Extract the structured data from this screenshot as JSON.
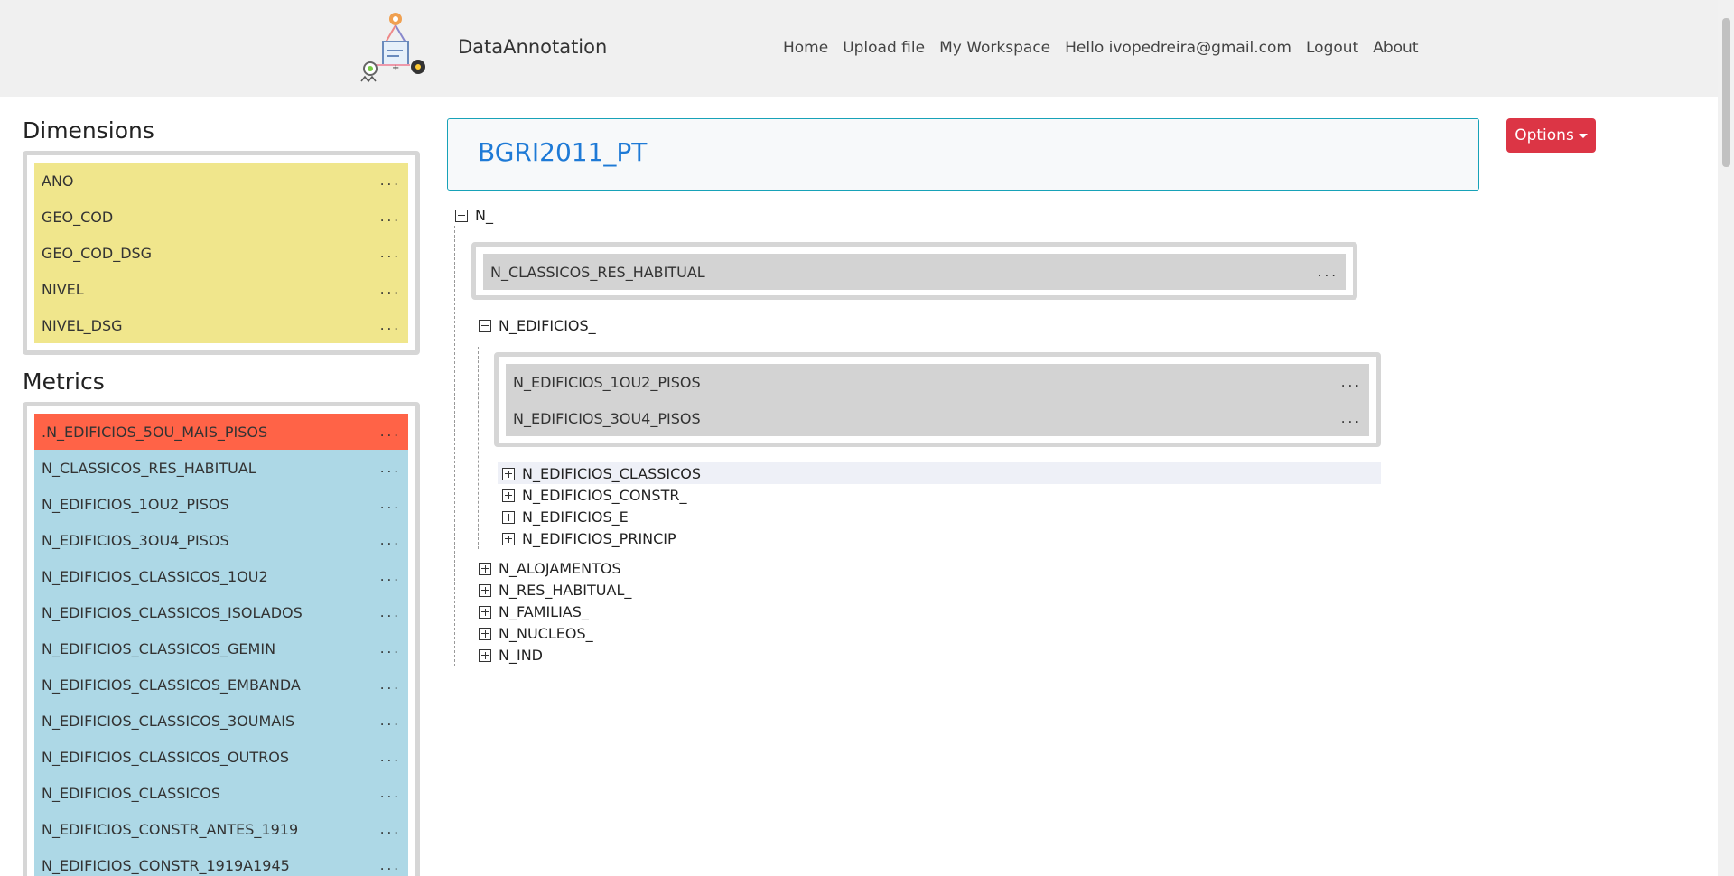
{
  "nav": {
    "brand": "DataAnnotation",
    "links": [
      "Home",
      "Upload file",
      "My Workspace",
      "Hello ivopedreira@gmail.com",
      "Logout",
      "About"
    ]
  },
  "sidebar": {
    "dimensions_title": "Dimensions",
    "dimensions": [
      "ANO",
      "GEO_COD",
      "GEO_COD_DSG",
      "NIVEL",
      "NIVEL_DSG"
    ],
    "metrics_title": "Metrics",
    "metrics": [
      ".N_EDIFICIOS_5OU_MAIS_PISOS",
      "N_CLASSICOS_RES_HABITUAL",
      "N_EDIFICIOS_1OU2_PISOS",
      "N_EDIFICIOS_3OU4_PISOS",
      "N_EDIFICIOS_CLASSICOS_1OU2",
      "N_EDIFICIOS_CLASSICOS_ISOLADOS",
      "N_EDIFICIOS_CLASSICOS_GEMIN",
      "N_EDIFICIOS_CLASSICOS_EMBANDA",
      "N_EDIFICIOS_CLASSICOS_3OUMAIS",
      "N_EDIFICIOS_CLASSICOS_OUTROS",
      "N_EDIFICIOS_CLASSICOS",
      "N_EDIFICIOS_CONSTR_ANTES_1919",
      "N_EDIFICIOS_CONSTR_1919A1945"
    ],
    "more_label": "...",
    "colors": {
      "dimension": "#f0e68c",
      "metric": "#add8e6",
      "metric_highlight": "#ff6347"
    }
  },
  "main": {
    "dataset_title": "BGRI2011_PT",
    "options_label": "Options",
    "tree": {
      "root": "N_",
      "root_group": [
        "N_CLASSICOS_RES_HABITUAL"
      ],
      "edificios": "N_EDIFICIOS_",
      "edificios_group": [
        "N_EDIFICIOS_1OU2_PISOS",
        "N_EDIFICIOS_3OU4_PISOS"
      ],
      "edificios_children": [
        "N_EDIFICIOS_CLASSICOS",
        "N_EDIFICIOS_CONSTR_",
        "N_EDIFICIOS_E",
        "N_EDIFICIOS_PRINCIP"
      ],
      "root_children": [
        "N_ALOJAMENTOS",
        "N_RES_HABITUAL_",
        "N_FAMILIAS_",
        "N_NUCLEOS_",
        "N_IND"
      ]
    }
  }
}
